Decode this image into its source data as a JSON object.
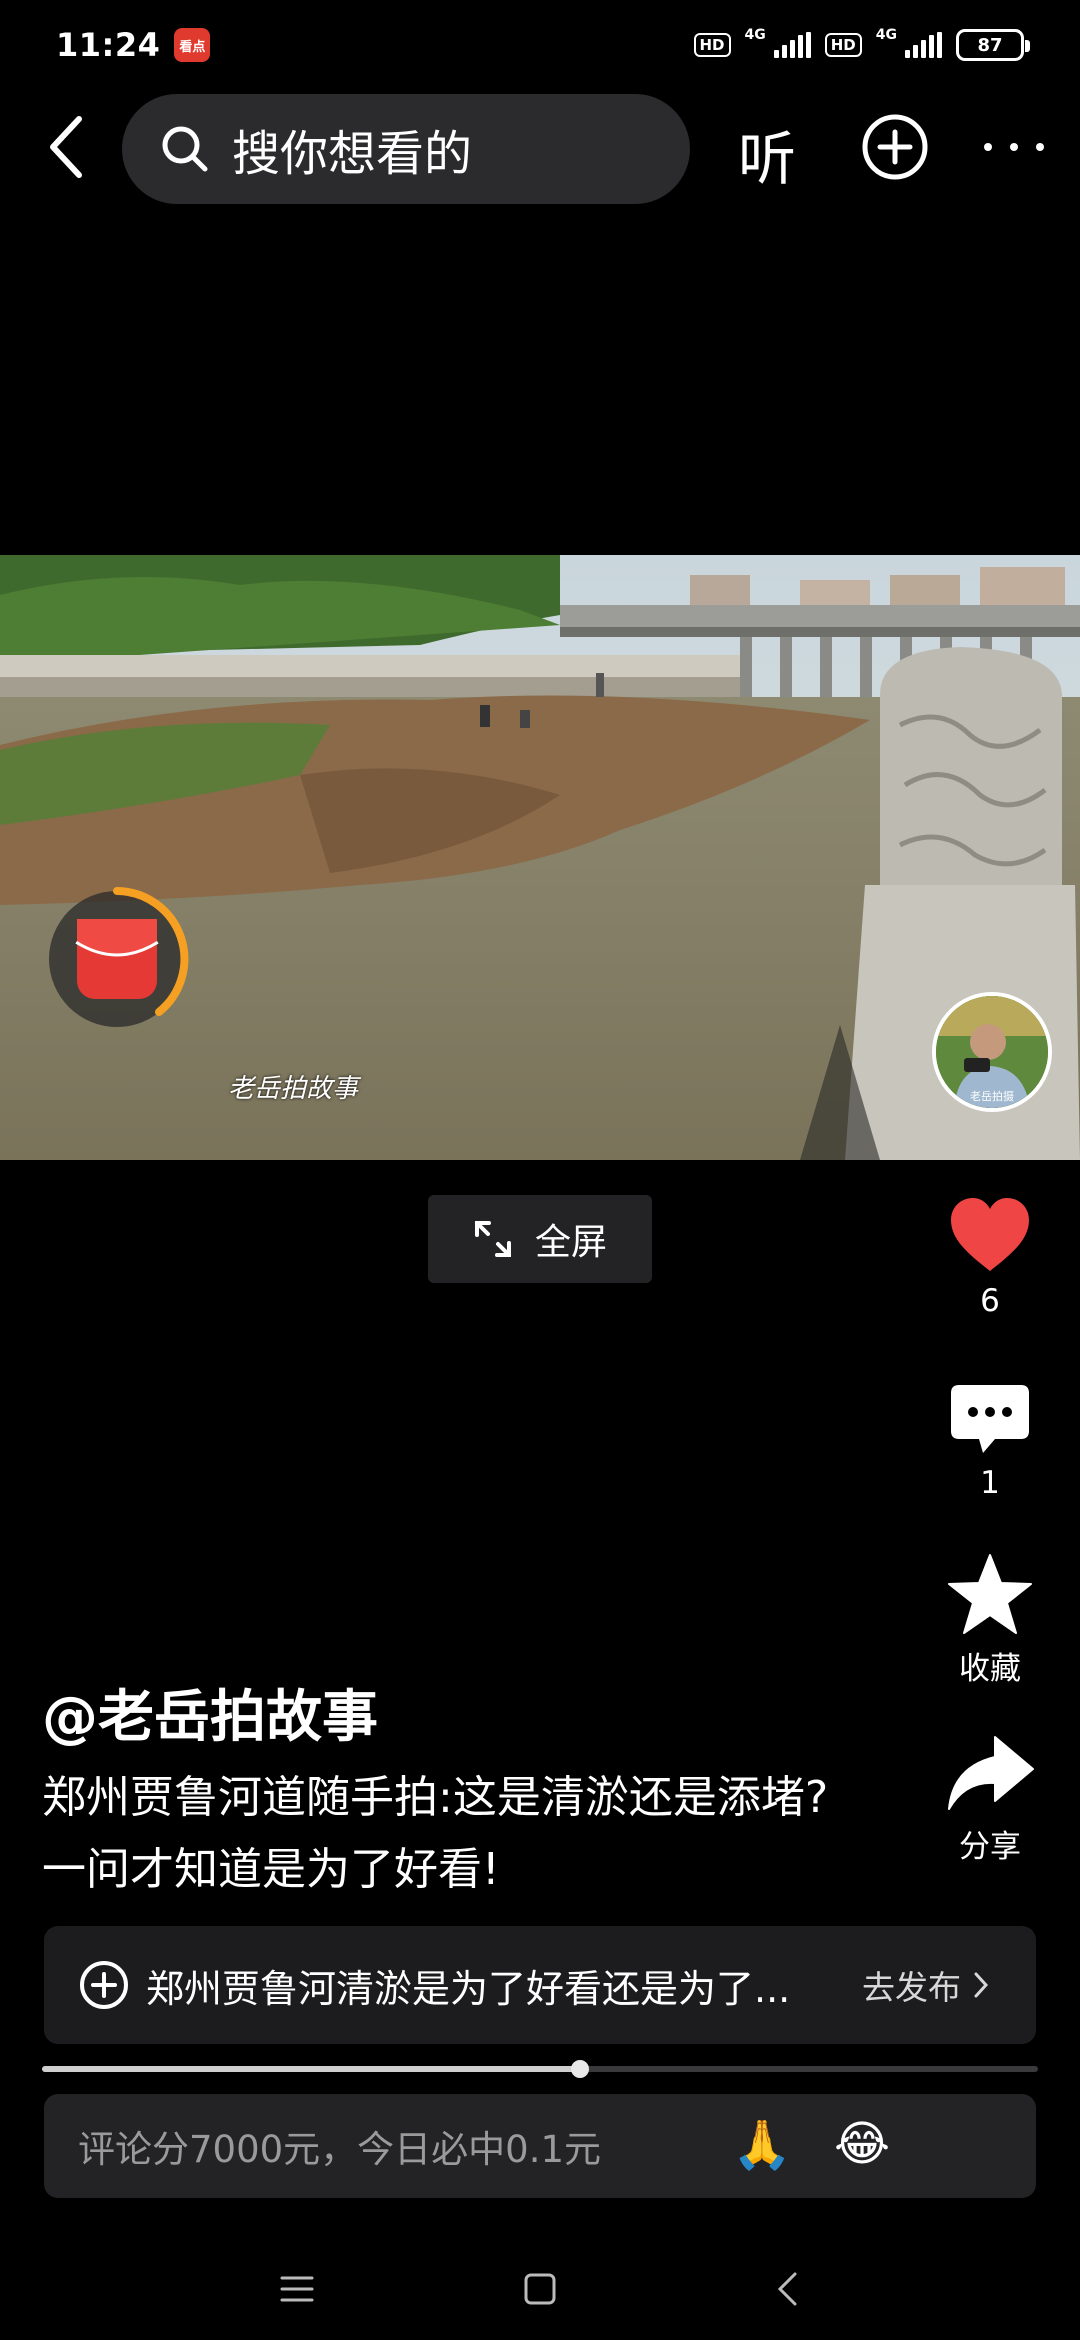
{
  "status_bar": {
    "time": "11:24",
    "app_badge": "看点",
    "network_1": "4G",
    "network_2": "4G",
    "hd_label": "HD",
    "battery": "87"
  },
  "top_nav": {
    "search_placeholder": "搜你想看的",
    "listen_label": "听"
  },
  "video": {
    "watermark": "老岳拍故事",
    "avatar_caption": "老岳拍摄"
  },
  "fullscreen_label": "全屏",
  "actions": {
    "like_count": "6",
    "comment_count": "1",
    "favorite_label": "收藏",
    "share_label": "分享",
    "like_color": "#f04545"
  },
  "post": {
    "author": "@老岳拍故事",
    "description": "郑州贾鲁河道随手拍:这是清淤还是添堵? 一问才知道是为了好看!"
  },
  "topic": {
    "text": "郑州贾鲁河清淤是为了好看还是为了...",
    "publish_label": "去发布"
  },
  "playback": {
    "progress_fraction": 0.54
  },
  "comment_input": {
    "placeholder": "评论分7000元，今日必中0.1元",
    "emoji_1": "🙏",
    "emoji_2": "😂"
  }
}
